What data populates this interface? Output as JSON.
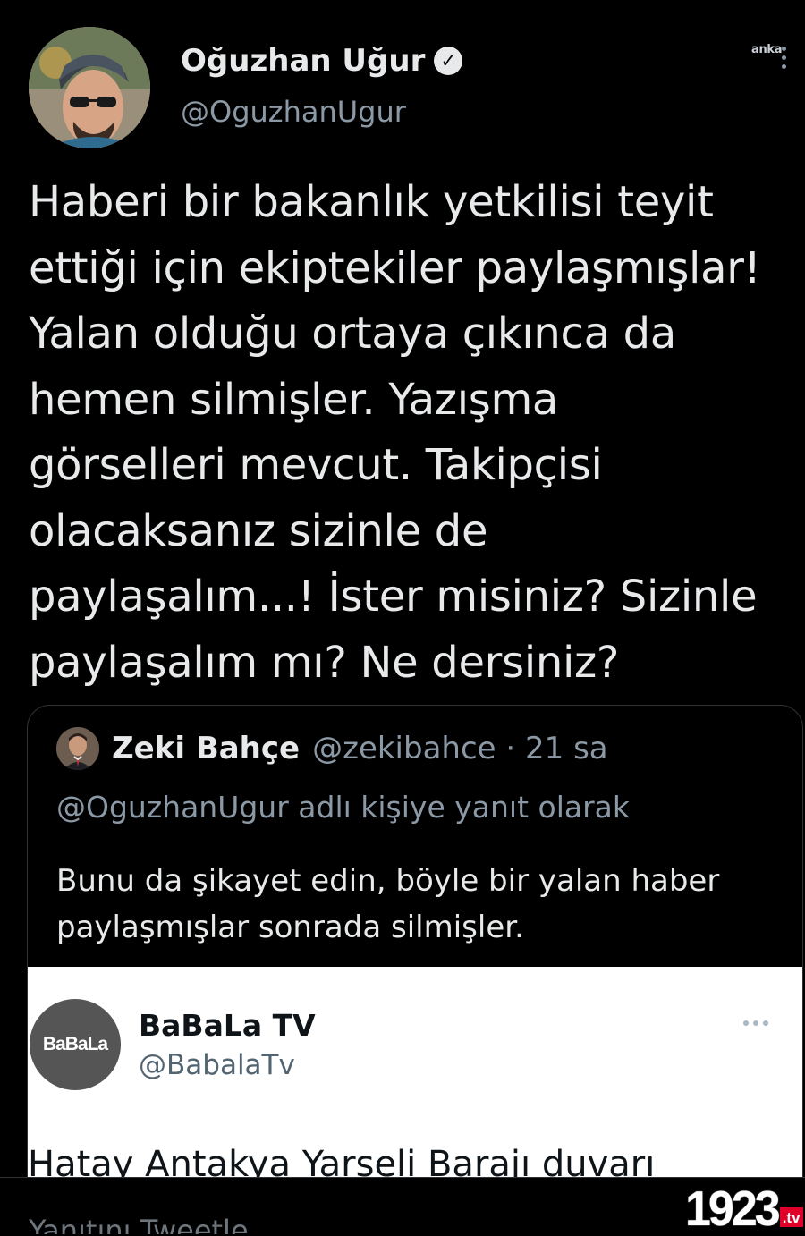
{
  "watermark_top": "anka",
  "author": {
    "name": "Oğuzhan Uğur",
    "handle": "@OguzhanUgur",
    "verified": true
  },
  "tweet": {
    "lines": [
      "Haberi bir bakanlık yetkilisi teyit",
      "ettiği için ekiptekiler paylaşmışlar!",
      "Yalan olduğu ortaya çıkınca da",
      "hemen silmişler. Yazışma",
      "görselleri mevcut. Takipçisi",
      "olacaksanız sizinle de",
      "paylaşalım...! İster misiniz? Sizinle",
      "paylaşalım mı? Ne dersiniz?"
    ]
  },
  "quote": {
    "name": "Zeki Bahçe",
    "meta": "@zekibahce · 21 sa",
    "replying_to": "@OguzhanUgur adlı kişiye yanıt olarak",
    "body_lines": [
      "Bunu da şikayet edin, böyle bir yalan haber",
      "paylaşmışlar sonrada silmişler."
    ],
    "embedded": {
      "logo_text": "BaBaLa",
      "name": "BaBaLa TV",
      "handle": "@BabalaTv",
      "text": "Hatay Antakya Yarseli Barajı duvarı"
    }
  },
  "reply_bar": {
    "text": "Yanıtını Tweetle"
  },
  "brand_logo": {
    "number": "1923",
    "suffix": ".tv",
    "accent": "#e0002a"
  },
  "colors": {
    "background": "#000000",
    "text_primary": "#e7e9ea",
    "text_secondary": "#8b98a5",
    "border": "#2f3336"
  }
}
